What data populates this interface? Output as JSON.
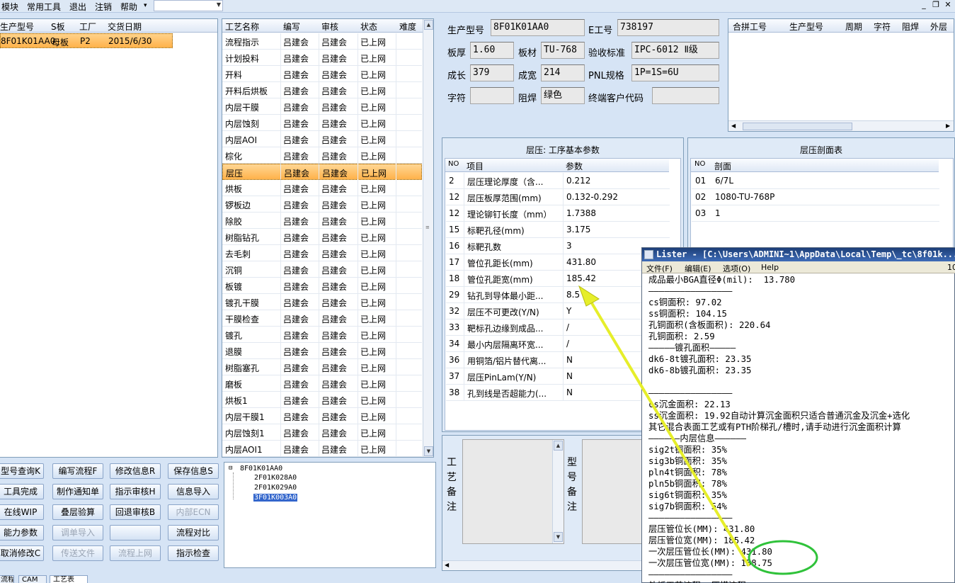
{
  "menu": {
    "items": [
      "模块",
      "常用工具",
      "退出",
      "注销",
      "帮助"
    ],
    "help_arrow": "▾"
  },
  "window_controls": {
    "minimize": "_",
    "restore": "❐",
    "close": "✕"
  },
  "customer_grid": {
    "headers": [
      "生产型号",
      "S板",
      "工厂",
      "交货日期"
    ],
    "row": [
      "8F01K01AA0",
      "母板",
      "P2",
      "2015/6/30"
    ]
  },
  "process_grid": {
    "headers": [
      "工艺名称",
      "编写",
      "审核",
      "状态",
      "难度"
    ],
    "rows": [
      [
        "流程指示",
        "吕建会",
        "吕建会",
        "已上网"
      ],
      [
        "计划投料",
        "吕建会",
        "吕建会",
        "已上网"
      ],
      [
        "开料",
        "吕建会",
        "吕建会",
        "已上网"
      ],
      [
        "开料后烘板",
        "吕建会",
        "吕建会",
        "已上网"
      ],
      [
        "内层干膜",
        "吕建会",
        "吕建会",
        "已上网"
      ],
      [
        "内层蚀刻",
        "吕建会",
        "吕建会",
        "已上网"
      ],
      [
        "内层AOI",
        "吕建会",
        "吕建会",
        "已上网"
      ],
      [
        "棕化",
        "吕建会",
        "吕建会",
        "已上网"
      ],
      [
        "层压",
        "吕建会",
        "吕建会",
        "已上网"
      ],
      [
        "烘板",
        "吕建会",
        "吕建会",
        "已上网"
      ],
      [
        "锣板边",
        "吕建会",
        "吕建会",
        "已上网"
      ],
      [
        "除胶",
        "吕建会",
        "吕建会",
        "已上网"
      ],
      [
        "树脂钻孔",
        "吕建会",
        "吕建会",
        "已上网"
      ],
      [
        "去毛刺",
        "吕建会",
        "吕建会",
        "已上网"
      ],
      [
        "沉铜",
        "吕建会",
        "吕建会",
        "已上网"
      ],
      [
        "板镀",
        "吕建会",
        "吕建会",
        "已上网"
      ],
      [
        "镀孔干膜",
        "吕建会",
        "吕建会",
        "已上网"
      ],
      [
        "干膜检查",
        "吕建会",
        "吕建会",
        "已上网"
      ],
      [
        "镀孔",
        "吕建会",
        "吕建会",
        "已上网"
      ],
      [
        "退膜",
        "吕建会",
        "吕建会",
        "已上网"
      ],
      [
        "树脂塞孔",
        "吕建会",
        "吕建会",
        "已上网"
      ],
      [
        "磨板",
        "吕建会",
        "吕建会",
        "已上网"
      ],
      [
        "烘板1",
        "吕建会",
        "吕建会",
        "已上网"
      ],
      [
        "内层干膜1",
        "吕建会",
        "吕建会",
        "已上网"
      ],
      [
        "内层蚀刻1",
        "吕建会",
        "吕建会",
        "已上网"
      ],
      [
        "内层AOI1",
        "吕建会",
        "吕建会",
        "已上网"
      ]
    ],
    "selected_index": 8
  },
  "buttons": [
    [
      "型号查询K",
      "编写流程F",
      "修改信息R",
      "保存信息S"
    ],
    [
      "工具完成",
      "制作通知单",
      "指示审核H",
      "信息导入"
    ],
    [
      "在线WIP",
      "叠层验算",
      "回退审核B",
      "内部ECN"
    ],
    [
      "能力参数",
      "调单导入",
      "",
      "流程对比"
    ],
    [
      "取消修改C",
      "传送文件",
      "流程上网",
      "指示检查"
    ]
  ],
  "disabled_buttons": [
    "内部ECN",
    "调单导入",
    "传送文件",
    "流程上网"
  ],
  "tree": {
    "root": "8F01K01AA0",
    "children": [
      "2F01K028A0",
      "2F01K029A0",
      "3F01K003A0"
    ],
    "root_toggle": "⊟"
  },
  "info": {
    "prod_label": "生产型号",
    "prod_value": "8F01K01AA0",
    "e_label": "E工号",
    "e_value": "738197",
    "thick_label": "板厚",
    "thick_value": "1.60",
    "mat_label": "板材",
    "mat_value": "TU-768",
    "std_label": "验收标准",
    "std_value": "IPC-6012 Ⅱ级",
    "len_label": "成长",
    "len_value": "379",
    "wid_label": "成宽",
    "wid_value": "214",
    "pnl_label": "PNL规格",
    "pnl_value": "1P=1S=6U",
    "char_label": "字符",
    "char_value": "",
    "mask_label": "阻焊",
    "mask_value": "绿色",
    "cust_label": "终端客户代码",
    "cust_value": ""
  },
  "merge_grid": {
    "headers": [
      "合拼工号",
      "生产型号",
      "周期",
      "字符",
      "阻焊",
      "外层"
    ]
  },
  "params": {
    "title": "层压: 工序基本参数",
    "headers": [
      "NO",
      "项目",
      "参数"
    ],
    "rows": [
      [
        "2",
        "层压理论厚度（含...",
        "0.212"
      ],
      [
        "12",
        "层压板厚范围(mm)",
        "0.132-0.292"
      ],
      [
        "12",
        "理论铆钉长度（mm）",
        "1.7388"
      ],
      [
        "15",
        "标靶孔径(mm)",
        "3.175"
      ],
      [
        "16",
        "标靶孔数",
        "3"
      ],
      [
        "17",
        "管位孔距长(mm)",
        "431.80"
      ],
      [
        "18",
        "管位孔距宽(mm)",
        "185.42"
      ],
      [
        "29",
        "钻孔到导体最小距...",
        "8.5"
      ],
      [
        "32",
        "层压不可更改(Y/N)",
        "Y"
      ],
      [
        "33",
        "靶标孔边缘到成品...",
        "/"
      ],
      [
        "34",
        "最小内层隔离环宽...",
        "/"
      ],
      [
        "36",
        "用铜箔/铝片替代离...",
        "N"
      ],
      [
        "37",
        "层压PinLam(Y/N)",
        "N"
      ],
      [
        "38",
        "孔到线是否超能力(...",
        "N"
      ]
    ]
  },
  "section": {
    "title": "层压剖面表",
    "headers": [
      "NO",
      "剖面"
    ],
    "rows": [
      [
        "01",
        "6/7L"
      ],
      [
        "02",
        "1080-TU-768P"
      ],
      [
        "03",
        "1"
      ]
    ]
  },
  "notes": {
    "craft_label": "工艺备注",
    "model_label": "型号备注"
  },
  "lister": {
    "title": "Lister - [C:\\Users\\ADMINI~1\\AppData\\Local\\Temp\\_tc\\8f01k...",
    "menu": [
      "文件(F)",
      "编辑(E)",
      "选项(O)",
      "Help"
    ],
    "menu_right": "10",
    "lines": [
      "成品最小BGA直径Φ(mil):  13.780",
      "————————————————",
      "cs铜面积: 97.02",
      "ss铜面积: 104.15",
      "孔铜面积(含板面积): 220.64",
      "孔铜面积: 2.59",
      "—————镀孔面积—————",
      "dk6-8t镀孔面积: 23.35",
      "dk6-8b镀孔面积: 23.35",
      "",
      "————————————————",
      "cs沉金面积: 22.13",
      "ss沉金面积: 19.92自动计算沉金面积只适合普通沉金及沉金+选化",
      "其它混合表面工艺或有PTH阶梯孔/槽时,请手动进行沉金面积计算",
      "——————内层信息——————",
      "sig2t铜面积: 35%",
      "sig3b铜面积: 35%",
      "pln4t铜面积: 78%",
      "pln5b铜面积: 78%",
      "sig6t铜面积: 35%",
      "sig7b铜面积: 54%",
      "————————————————",
      "层压管位长(MM): 431.80",
      "层压管位宽(MM): 185.42",
      "一次层压管位长(MM): 431.80",
      "一次层压管位宽(MM): 158.75",
      "————————————————",
      "外板工艺流程, 压模流程"
    ]
  },
  "bottom_tabs": [
    "流程",
    "CAM",
    "工艺表"
  ],
  "colors": {
    "highlight": "#ffb24a",
    "arrow": "#e6ee2a",
    "circle": "#2fc23a"
  }
}
